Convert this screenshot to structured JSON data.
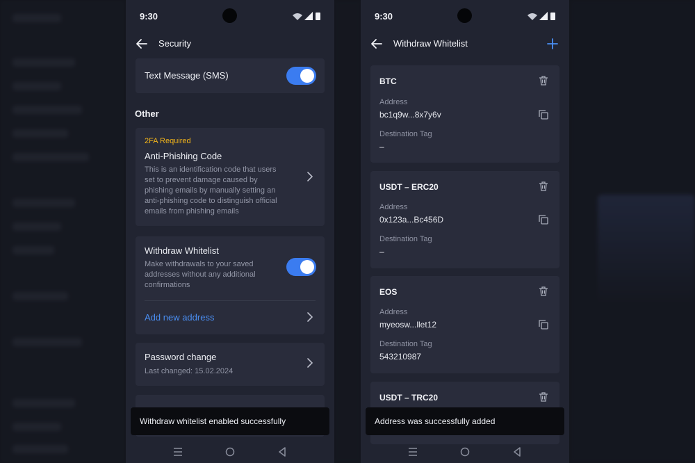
{
  "status_bar": {
    "time": "9:30"
  },
  "security_screen": {
    "title": "Security",
    "sms": {
      "label": "Text Message (SMS)"
    },
    "section_other": "Other",
    "anti_phishing": {
      "badge": "2FA Required",
      "title": "Anti-Phishing Code",
      "desc_lines": [
        "This is an identification code that users",
        "set to prevent damage caused by",
        "phishing emails by manually setting an",
        "anti-phishing code to distinguish official",
        "emails from phishing emails"
      ]
    },
    "withdraw_whitelist": {
      "title": "Withdraw Whitelist",
      "desc_lines": [
        "Make withdrawals to your saved",
        "addresses without any additional",
        "confirmations"
      ],
      "add_link": "Add new address"
    },
    "password_change": {
      "title": "Password change",
      "subtitle": "Last changed: 15.02.2024"
    },
    "toast": "Withdraw whitelist enabled successfully"
  },
  "whitelist_screen": {
    "title": "Withdraw Whitelist",
    "address_label": "Address",
    "tag_label": "Destination Tag",
    "items": [
      {
        "coin": "BTC",
        "address": "bc1q9w...8x7y6v",
        "tag": "–"
      },
      {
        "coin": "USDT – ERC20",
        "address": "0x123a...Bc456D",
        "tag": "–"
      },
      {
        "coin": "EOS",
        "address": "myeosw...llet12",
        "tag": "543210987"
      },
      {
        "coin": "USDT – TRC20"
      }
    ],
    "toast": "Address was successfully added"
  },
  "colors": {
    "accent": "#3b7cf0",
    "link": "#4a8ef2",
    "warning": "#f3b51a",
    "card": "#292c3b",
    "screen": "#212431"
  }
}
